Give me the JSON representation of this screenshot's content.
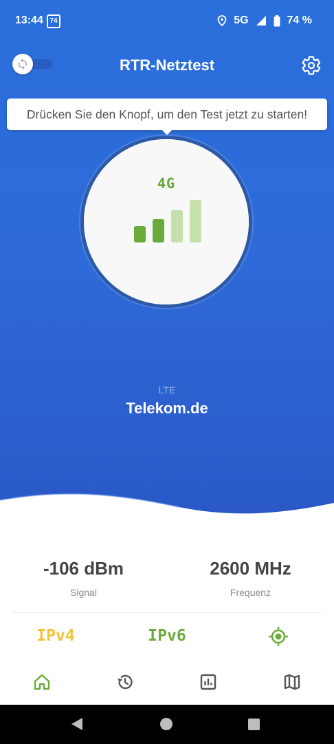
{
  "status_bar": {
    "time": "13:44",
    "app_badge": "74",
    "network": "5G",
    "battery": "74 %"
  },
  "header": {
    "title": "RTR-Netztest",
    "toggle_icon": "sync-icon",
    "settings_icon": "gear-icon"
  },
  "tooltip": {
    "text": "Drücken Sie den Knopf, um den Test jetzt zu starten!"
  },
  "start_button": {
    "network_tech": "4G",
    "signal_strength": "2 of 4 bars"
  },
  "network": {
    "technology": "LTE",
    "operator": "Telekom.de"
  },
  "stats": {
    "signal_value": "-106 dBm",
    "signal_label": "Signal",
    "frequency_value": "2600 MHz",
    "frequency_label": "Frequenz"
  },
  "ip": {
    "ipv4": "IPv4",
    "ipv6": "IPv6",
    "ipv4_color": "#f2c237",
    "ipv6_color": "#6aab3a",
    "location_icon": "location-target-icon"
  },
  "bottom_nav": {
    "items": [
      "home-icon",
      "history-icon",
      "statistics-icon",
      "map-icon"
    ],
    "active_color": "#6aab3a"
  },
  "colors": {
    "primary": "#2e6ad9",
    "accent_green": "#6aab3a",
    "light_green": "#c6e0ad"
  }
}
